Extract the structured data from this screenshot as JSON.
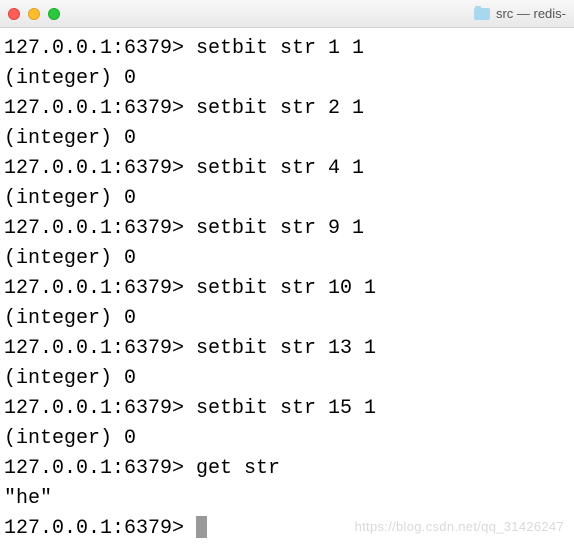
{
  "titlebar": {
    "folder_label": "src — redis-"
  },
  "terminal": {
    "prompt": "127.0.0.1:6379>",
    "lines": [
      {
        "prompt": "127.0.0.1:6379>",
        "cmd": " setbit str 1 1"
      },
      {
        "out": "(integer) 0"
      },
      {
        "prompt": "127.0.0.1:6379>",
        "cmd": " setbit str 2 1"
      },
      {
        "out": "(integer) 0"
      },
      {
        "prompt": "127.0.0.1:6379>",
        "cmd": " setbit str 4 1"
      },
      {
        "out": "(integer) 0"
      },
      {
        "prompt": "127.0.0.1:6379>",
        "cmd": " setbit str 9 1"
      },
      {
        "out": "(integer) 0"
      },
      {
        "prompt": "127.0.0.1:6379>",
        "cmd": " setbit str 10 1"
      },
      {
        "out": "(integer) 0"
      },
      {
        "prompt": "127.0.0.1:6379>",
        "cmd": " setbit str 13 1"
      },
      {
        "out": "(integer) 0"
      },
      {
        "prompt": "127.0.0.1:6379>",
        "cmd": " setbit str 15 1"
      },
      {
        "out": "(integer) 0"
      },
      {
        "prompt": "127.0.0.1:6379>",
        "cmd": " get str"
      },
      {
        "out": "\"he\""
      },
      {
        "prompt": "127.0.0.1:6379>",
        "cmd": " ",
        "cursor": true
      }
    ]
  },
  "watermark": "https://blog.csdn.net/qq_31426247"
}
